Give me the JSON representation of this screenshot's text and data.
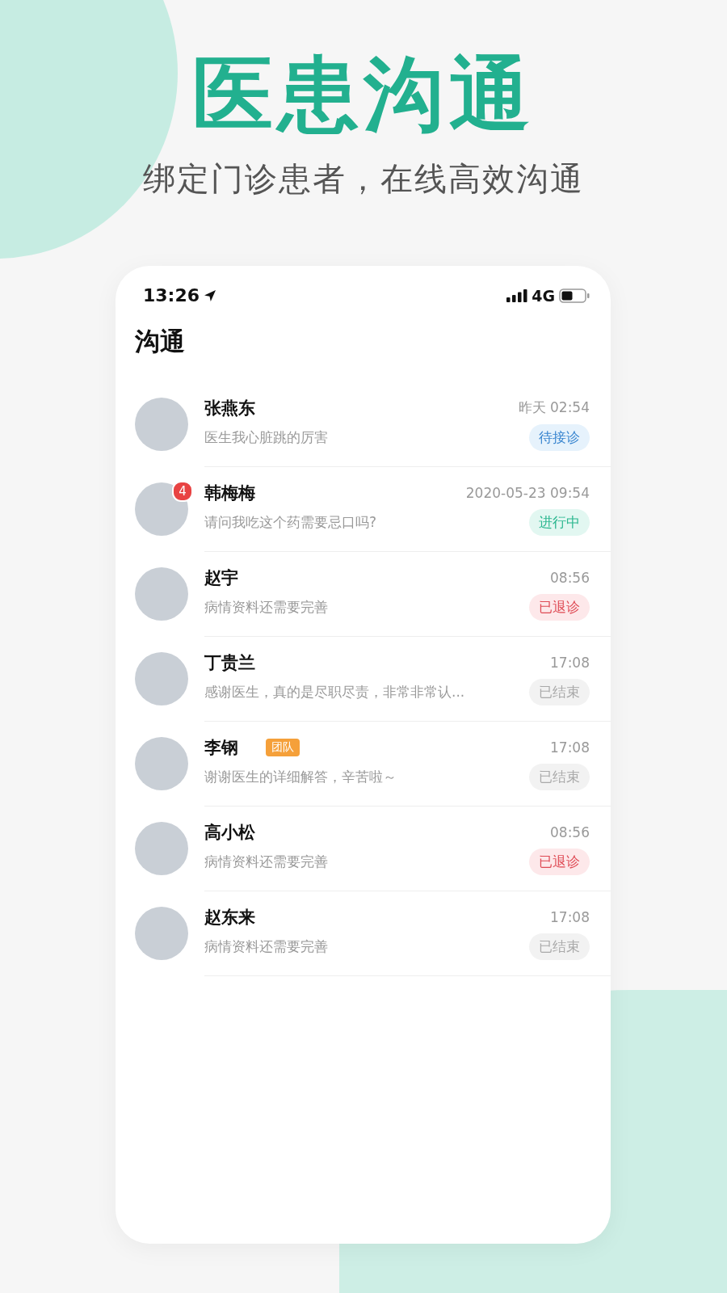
{
  "headline": "医患沟通",
  "subtitle": "绑定门诊患者，在线高效沟通",
  "status_bar": {
    "time": "13:26",
    "network": "4G"
  },
  "screen_title": "沟通",
  "conversations": [
    {
      "name": "张燕东",
      "message": "医生我心脏跳的厉害",
      "time": "昨天 02:54",
      "status": {
        "kind": "waiting",
        "label": "待接诊"
      }
    },
    {
      "name": "韩梅梅",
      "unread": "4",
      "message": "请问我吃这个药需要忌口吗?",
      "time": "2020-05-23 09:54",
      "status": {
        "kind": "ongoing",
        "label": "进行中"
      }
    },
    {
      "name": "赵宇",
      "message": "病情资料还需要完善",
      "time": "08:56",
      "status": {
        "kind": "withdrawn",
        "label": "已退诊"
      }
    },
    {
      "name": "丁贵兰",
      "message": "感谢医生，真的是尽职尽责，非常非常认...",
      "time": "17:08",
      "status": {
        "kind": "ended",
        "label": "已结束"
      }
    },
    {
      "name": "李钢",
      "tag": "团队",
      "message": "谢谢医生的详细解答，辛苦啦～",
      "time": "17:08",
      "status": {
        "kind": "ended",
        "label": "已结束"
      }
    },
    {
      "name": "高小松",
      "message": "病情资料还需要完善",
      "time": "08:56",
      "status": {
        "kind": "withdrawn",
        "label": "已退诊"
      }
    },
    {
      "name": "赵东来",
      "message": "病情资料还需要完善",
      "time": "17:08",
      "status": {
        "kind": "ended",
        "label": "已结束"
      }
    }
  ]
}
